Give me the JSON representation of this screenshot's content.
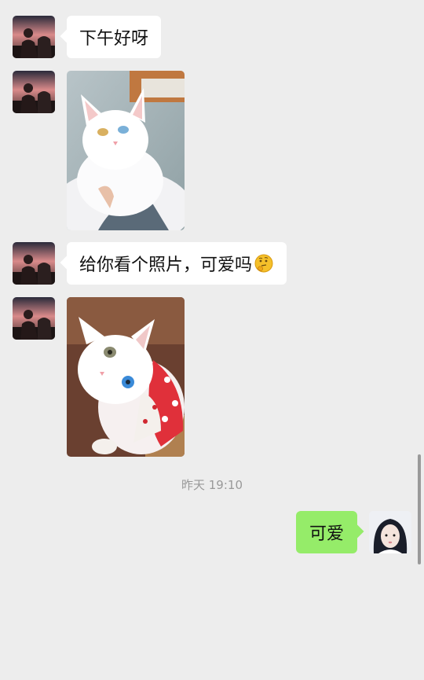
{
  "messages": {
    "m1": {
      "text": "下午好呀"
    },
    "m2": {
      "image": "white-cat-held-photo"
    },
    "m3": {
      "text": "给你看个照片，可爱吗",
      "emoji": "thinking-face-emoji"
    },
    "m4": {
      "image": "white-cat-sweater-photo"
    },
    "timestamp": "昨天 19:10",
    "m5": {
      "text": "可爱"
    }
  },
  "colors": {
    "background": "#ededed",
    "incoming_bubble": "#ffffff",
    "outgoing_bubble": "#95ec69",
    "timestamp_text": "#999999"
  }
}
